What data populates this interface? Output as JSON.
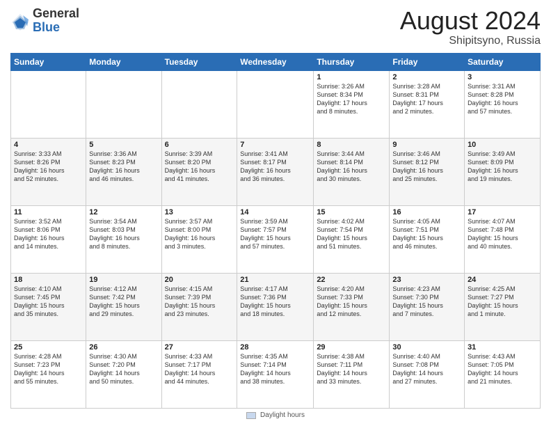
{
  "logo": {
    "general": "General",
    "blue": "Blue",
    "icon_title": "GeneralBlue logo"
  },
  "title": {
    "month_year": "August 2024",
    "location": "Shipitsyno, Russia"
  },
  "weekdays": [
    "Sunday",
    "Monday",
    "Tuesday",
    "Wednesday",
    "Thursday",
    "Friday",
    "Saturday"
  ],
  "footer": {
    "swatch_label": "Daylight hours"
  },
  "weeks": [
    [
      {
        "day": "",
        "info": ""
      },
      {
        "day": "",
        "info": ""
      },
      {
        "day": "",
        "info": ""
      },
      {
        "day": "",
        "info": ""
      },
      {
        "day": "1",
        "info": "Sunrise: 3:26 AM\nSunset: 8:34 PM\nDaylight: 17 hours\nand 8 minutes."
      },
      {
        "day": "2",
        "info": "Sunrise: 3:28 AM\nSunset: 8:31 PM\nDaylight: 17 hours\nand 2 minutes."
      },
      {
        "day": "3",
        "info": "Sunrise: 3:31 AM\nSunset: 8:28 PM\nDaylight: 16 hours\nand 57 minutes."
      }
    ],
    [
      {
        "day": "4",
        "info": "Sunrise: 3:33 AM\nSunset: 8:26 PM\nDaylight: 16 hours\nand 52 minutes."
      },
      {
        "day": "5",
        "info": "Sunrise: 3:36 AM\nSunset: 8:23 PM\nDaylight: 16 hours\nand 46 minutes."
      },
      {
        "day": "6",
        "info": "Sunrise: 3:39 AM\nSunset: 8:20 PM\nDaylight: 16 hours\nand 41 minutes."
      },
      {
        "day": "7",
        "info": "Sunrise: 3:41 AM\nSunset: 8:17 PM\nDaylight: 16 hours\nand 36 minutes."
      },
      {
        "day": "8",
        "info": "Sunrise: 3:44 AM\nSunset: 8:14 PM\nDaylight: 16 hours\nand 30 minutes."
      },
      {
        "day": "9",
        "info": "Sunrise: 3:46 AM\nSunset: 8:12 PM\nDaylight: 16 hours\nand 25 minutes."
      },
      {
        "day": "10",
        "info": "Sunrise: 3:49 AM\nSunset: 8:09 PM\nDaylight: 16 hours\nand 19 minutes."
      }
    ],
    [
      {
        "day": "11",
        "info": "Sunrise: 3:52 AM\nSunset: 8:06 PM\nDaylight: 16 hours\nand 14 minutes."
      },
      {
        "day": "12",
        "info": "Sunrise: 3:54 AM\nSunset: 8:03 PM\nDaylight: 16 hours\nand 8 minutes."
      },
      {
        "day": "13",
        "info": "Sunrise: 3:57 AM\nSunset: 8:00 PM\nDaylight: 16 hours\nand 3 minutes."
      },
      {
        "day": "14",
        "info": "Sunrise: 3:59 AM\nSunset: 7:57 PM\nDaylight: 15 hours\nand 57 minutes."
      },
      {
        "day": "15",
        "info": "Sunrise: 4:02 AM\nSunset: 7:54 PM\nDaylight: 15 hours\nand 51 minutes."
      },
      {
        "day": "16",
        "info": "Sunrise: 4:05 AM\nSunset: 7:51 PM\nDaylight: 15 hours\nand 46 minutes."
      },
      {
        "day": "17",
        "info": "Sunrise: 4:07 AM\nSunset: 7:48 PM\nDaylight: 15 hours\nand 40 minutes."
      }
    ],
    [
      {
        "day": "18",
        "info": "Sunrise: 4:10 AM\nSunset: 7:45 PM\nDaylight: 15 hours\nand 35 minutes."
      },
      {
        "day": "19",
        "info": "Sunrise: 4:12 AM\nSunset: 7:42 PM\nDaylight: 15 hours\nand 29 minutes."
      },
      {
        "day": "20",
        "info": "Sunrise: 4:15 AM\nSunset: 7:39 PM\nDaylight: 15 hours\nand 23 minutes."
      },
      {
        "day": "21",
        "info": "Sunrise: 4:17 AM\nSunset: 7:36 PM\nDaylight: 15 hours\nand 18 minutes."
      },
      {
        "day": "22",
        "info": "Sunrise: 4:20 AM\nSunset: 7:33 PM\nDaylight: 15 hours\nand 12 minutes."
      },
      {
        "day": "23",
        "info": "Sunrise: 4:23 AM\nSunset: 7:30 PM\nDaylight: 15 hours\nand 7 minutes."
      },
      {
        "day": "24",
        "info": "Sunrise: 4:25 AM\nSunset: 7:27 PM\nDaylight: 15 hours\nand 1 minute."
      }
    ],
    [
      {
        "day": "25",
        "info": "Sunrise: 4:28 AM\nSunset: 7:23 PM\nDaylight: 14 hours\nand 55 minutes."
      },
      {
        "day": "26",
        "info": "Sunrise: 4:30 AM\nSunset: 7:20 PM\nDaylight: 14 hours\nand 50 minutes."
      },
      {
        "day": "27",
        "info": "Sunrise: 4:33 AM\nSunset: 7:17 PM\nDaylight: 14 hours\nand 44 minutes."
      },
      {
        "day": "28",
        "info": "Sunrise: 4:35 AM\nSunset: 7:14 PM\nDaylight: 14 hours\nand 38 minutes."
      },
      {
        "day": "29",
        "info": "Sunrise: 4:38 AM\nSunset: 7:11 PM\nDaylight: 14 hours\nand 33 minutes."
      },
      {
        "day": "30",
        "info": "Sunrise: 4:40 AM\nSunset: 7:08 PM\nDaylight: 14 hours\nand 27 minutes."
      },
      {
        "day": "31",
        "info": "Sunrise: 4:43 AM\nSunset: 7:05 PM\nDaylight: 14 hours\nand 21 minutes."
      }
    ]
  ]
}
